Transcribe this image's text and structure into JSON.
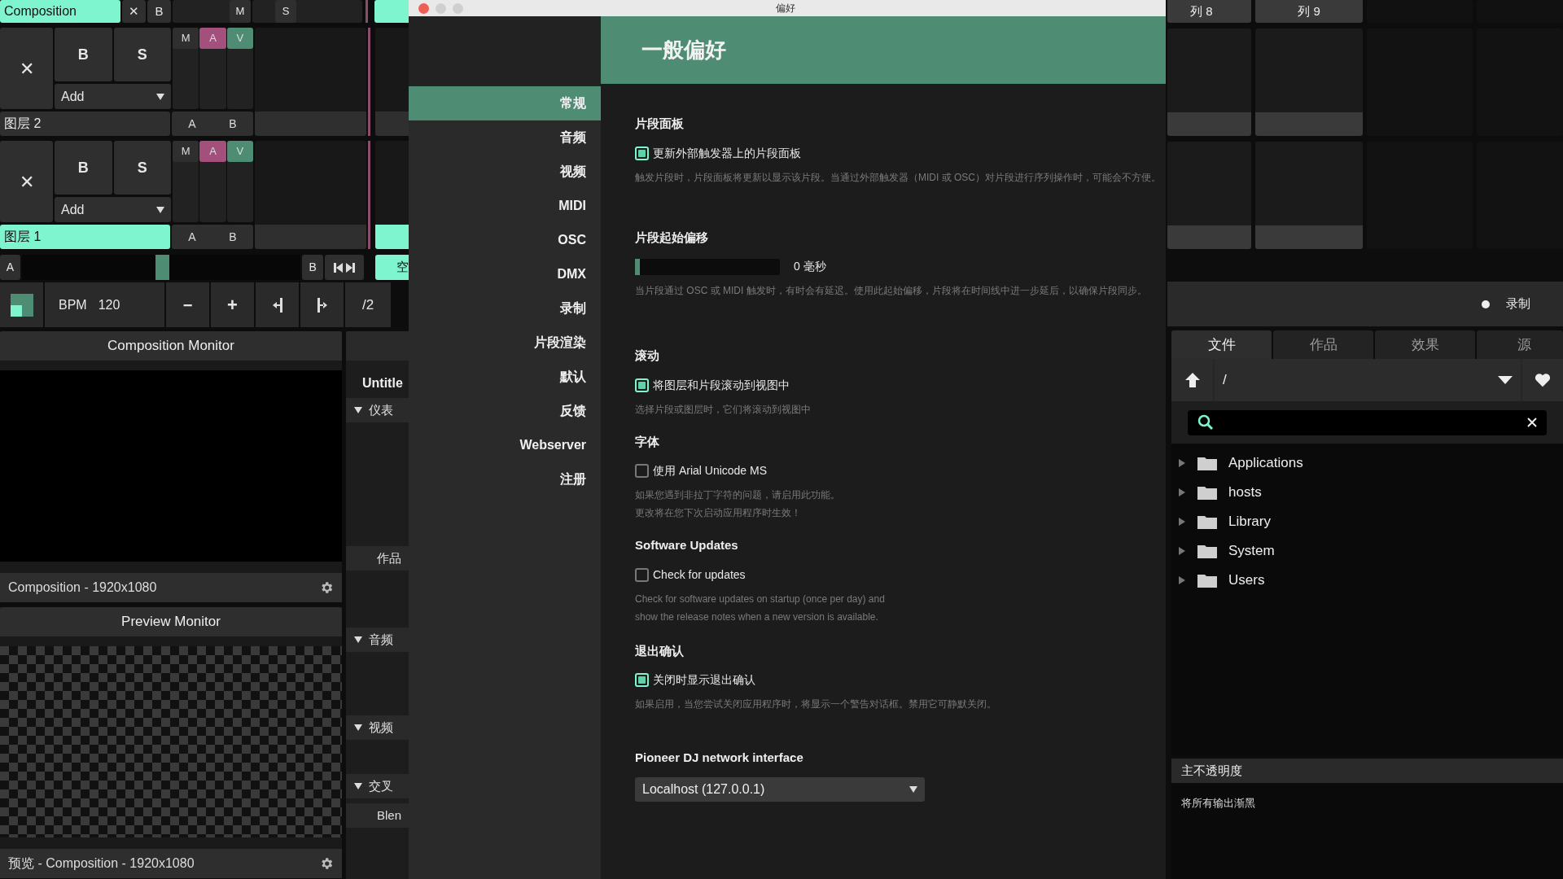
{
  "composition": {
    "name": "Composition",
    "buttons": [
      "✕",
      "B"
    ],
    "mute": "M",
    "solo": "S"
  },
  "layers": [
    {
      "name": "图层 2",
      "selected": false,
      "clear": "✕",
      "bypass": "B",
      "solo": "S",
      "blend": "Add",
      "toggles": [
        {
          "label": "M",
          "on": false
        },
        {
          "label": "A",
          "on": true
        },
        {
          "label": "V",
          "on": true
        }
      ],
      "a": "A",
      "b": "B"
    },
    {
      "name": "图层 1",
      "selected": true,
      "clear": "✕",
      "bypass": "B",
      "solo": "S",
      "blend": "Add",
      "toggles": [
        {
          "label": "M",
          "on": false
        },
        {
          "label": "A",
          "on": true
        },
        {
          "label": "V",
          "on": true
        }
      ],
      "a": "A",
      "b": "B"
    }
  ],
  "column_strip": {
    "clip_label": "空"
  },
  "crossfader": {
    "a": "A",
    "b": "B",
    "level": 0.5
  },
  "bpm": {
    "label": "BPM",
    "value": "120",
    "minus": "−",
    "plus": "+",
    "half": "/2"
  },
  "composition_monitor": {
    "title": "Composition Monitor",
    "footer": "Composition - 1920x1080"
  },
  "preview_monitor": {
    "title": "Preview Monitor",
    "footer": "预览 - Composition - 1920x1080"
  },
  "side_panel": {
    "title": "Untitle",
    "items": [
      {
        "kind": "group",
        "label": "仪表"
      },
      {
        "kind": "item",
        "label": "作品"
      },
      {
        "kind": "group",
        "label": "音频"
      },
      {
        "kind": "group",
        "label": "视频"
      },
      {
        "kind": "group",
        "label": "交叉"
      },
      {
        "kind": "item",
        "label": "Blen"
      }
    ]
  },
  "preferences": {
    "title": "偏好",
    "heading": "一般偏好",
    "nav": [
      {
        "label": "常规",
        "selected": true
      },
      {
        "label": "音频",
        "selected": false
      },
      {
        "label": "视频",
        "selected": false
      },
      {
        "label": "MIDI",
        "selected": false
      },
      {
        "label": "OSC",
        "selected": false
      },
      {
        "label": "DMX",
        "selected": false
      },
      {
        "label": "录制",
        "selected": false
      },
      {
        "label": "片段渲染",
        "selected": false
      },
      {
        "label": "默认",
        "selected": false
      },
      {
        "label": "反馈",
        "selected": false
      },
      {
        "label": "Webserver",
        "selected": false
      },
      {
        "label": "注册",
        "selected": false
      }
    ],
    "sections": [
      {
        "kind": "checkbox",
        "title": "片段面板",
        "label": "更新外部触发器上的片段面板",
        "checked": true,
        "description": [
          "触发片段时，片段面板将更新以显示该片段。当通过外部触发器（MIDI 或 OSC）对片段进行序列操作时，可能会不方便。"
        ]
      },
      {
        "kind": "slider",
        "title": "片段起始偏移",
        "level": 0,
        "reading": "0 毫秒",
        "description": [
          "当片段通过 OSC 或 MIDI 触发时，有时会有延迟。使用此起始偏移，片段将在时间线中进一步延后，以确保片段同步。"
        ]
      },
      {
        "kind": "checkbox",
        "title": "滚动",
        "label": "将图层和片段滚动到视图中",
        "checked": true,
        "description": [
          "选择片段或图层时，它们将滚动到视图中"
        ]
      },
      {
        "kind": "checkbox",
        "title": "字体",
        "label": "使用 Arial Unicode MS",
        "checked": false,
        "description": [
          "如果您遇到非拉丁字符的问题，请启用此功能。",
          "更改将在您下次启动应用程序时生效！"
        ]
      },
      {
        "kind": "checkbox",
        "title": "Software Updates",
        "label": "Check for updates",
        "checked": false,
        "description": [
          "Check for software updates on startup (once per day) and",
          "show the release notes when a new version is available."
        ]
      },
      {
        "kind": "checkbox",
        "title": "退出确认",
        "label": "关闭时显示退出确认",
        "checked": true,
        "description": [
          "如果启用，当您尝试关闭应用程序时，将显示一个警告对话框。禁用它可静默关闭。"
        ]
      },
      {
        "kind": "select",
        "title": "Pioneer DJ network interface",
        "value": "Localhost (127.0.0.1)"
      }
    ]
  },
  "columns": [
    {
      "label": "列 8"
    },
    {
      "label": "列 9"
    }
  ],
  "record": {
    "label": "录制"
  },
  "browser": {
    "tabs": [
      {
        "label": "文件",
        "selected": true
      },
      {
        "label": "作品",
        "selected": false
      },
      {
        "label": "效果",
        "selected": false
      },
      {
        "label": "源",
        "selected": false
      }
    ],
    "path": "/",
    "tree": [
      {
        "label": "Applications",
        "expanded": false
      },
      {
        "label": "hosts",
        "expanded": false
      },
      {
        "label": "Library",
        "expanded": false
      },
      {
        "label": "System",
        "expanded": false
      },
      {
        "label": "Users",
        "expanded": false
      }
    ]
  },
  "opacity": {
    "title": "主不透明度",
    "description": "将所有输出渐黑"
  }
}
